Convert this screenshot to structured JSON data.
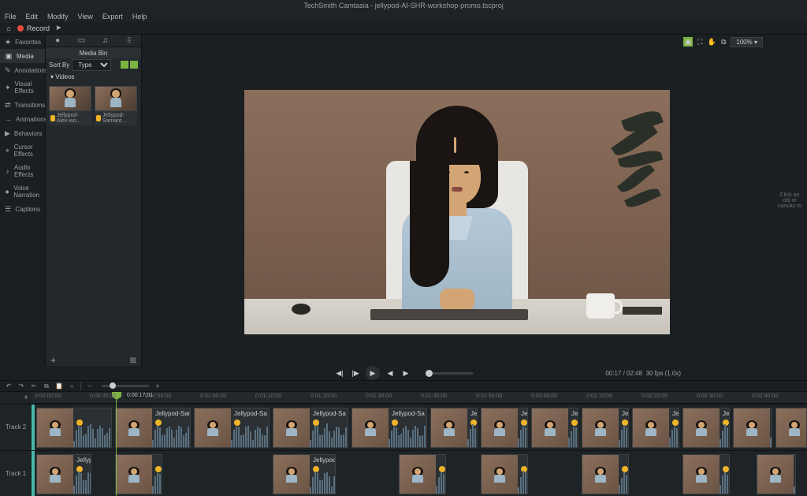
{
  "title": "TechSmith Camtasia - jellypod-AI-SHR-workshop-promo.tscproj",
  "menu": {
    "file": "File",
    "edit": "Edit",
    "modify": "Modify",
    "view": "View",
    "export": "Export",
    "help": "Help"
  },
  "toolbar": {
    "record": "Record"
  },
  "sidebar": {
    "items": [
      {
        "icon": "★",
        "label": "Favorites"
      },
      {
        "icon": "▣",
        "label": "Media"
      },
      {
        "icon": "✎",
        "label": "Annotations"
      },
      {
        "icon": "✦",
        "label": "Visual Effects"
      },
      {
        "icon": "⇄",
        "label": "Transitions"
      },
      {
        "icon": "→",
        "label": "Animations"
      },
      {
        "icon": "▶",
        "label": "Behaviors"
      },
      {
        "icon": "⌖",
        "label": "Cursor Effects"
      },
      {
        "icon": "♪",
        "label": "Audio Effects"
      },
      {
        "icon": "●",
        "label": "Voice Narration"
      },
      {
        "icon": "☰",
        "label": "Captions"
      }
    ]
  },
  "panel": {
    "header": "Media Bin",
    "sort_label": "Sort By",
    "sort_value": "Type",
    "section": "▾ Videos",
    "thumbs": [
      {
        "label": "Jellypod-Alex-wo..."
      },
      {
        "label": "Jellypod-Samant..."
      }
    ]
  },
  "canvas": {
    "zoom": "100%"
  },
  "props": {
    "hint": "Click an obj or canvas to"
  },
  "playback": {
    "time": "00:17 / 02:48",
    "fps": "30 fps (1.0x)"
  },
  "timeline": {
    "playhead": "0:00:17;01",
    "marks": [
      "0:00:00;00",
      "0:00:30;00",
      "0:00:50;00",
      "0:01:00;00",
      "0:01:10;00",
      "0:01:20;00",
      "0:01:30;00",
      "0:01:40;00",
      "0:01:50;00",
      "0:02:00;00",
      "0:02:10;00",
      "0:02:20;00",
      "0:02:30;00",
      "0:02:40;00"
    ],
    "tracks": [
      "Track 2",
      "Track 1"
    ],
    "clip_label": "Jellypod-Samantha-workshop-promo",
    "clip_label_short": "Jellypod-Sa",
    "clip_label_short2": "Jellypod-S",
    "clip_label_t1": "Jellypod"
  }
}
